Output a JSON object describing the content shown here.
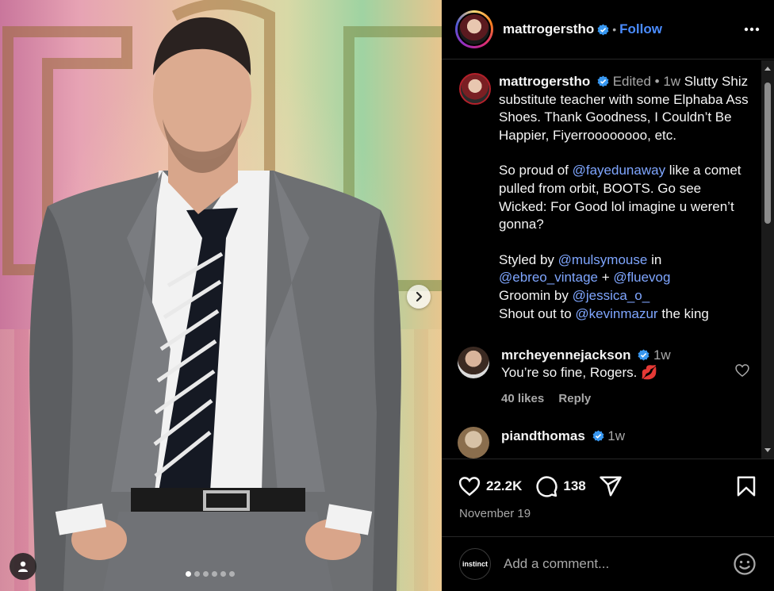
{
  "post": {
    "username": "mattrogerstho",
    "follow_label": "Follow",
    "header_separator": "•"
  },
  "caption": {
    "username": "mattrogerstho",
    "edited": "Edited",
    "bullet": "•",
    "time": "1w",
    "para1": "Slutty Shiz substitute teacher with some Elphaba Ass Shoes. Thank Goodness, I Couldn’t Be Happier, Fiyerroooooooo, etc.",
    "para2_before": "So proud of ",
    "para2_mention": "@fayedunaway",
    "para2_after": " like a comet pulled from orbit, BOOTS. Go see Wicked: For Good lol imagine u weren’t gonna?",
    "styled_by": "Styled by ",
    "styled_mention1": "@mulsymouse",
    "styled_in": " in",
    "styled_mention2": "@ebreo_vintage",
    "styled_plus": " + ",
    "styled_mention3": "@fluevog",
    "groomin_by": "Groomin by ",
    "groomin_mention": "@jessica_o_",
    "shout_out": "Shout out to ",
    "shout_mention": "@kevinmazur",
    "shout_after": " the king"
  },
  "comments": [
    {
      "username": "mrcheyennejackson",
      "time": "1w",
      "text": "You’re so fine, Rogers. 💋",
      "likes": "40 likes",
      "reply_label": "Reply"
    },
    {
      "username": "piandthomas",
      "time": "1w"
    }
  ],
  "stats": {
    "likes": "22.2K",
    "comments": "138",
    "date": "November 19"
  },
  "composer": {
    "placeholder": "Add a comment...",
    "avatar_text": "instinct"
  },
  "carousel": {
    "slide_count": 6,
    "active_index": 0
  },
  "colors": {
    "accent": "#4a8cff",
    "mention": "#7fa6ff",
    "muted": "#a8a8a8",
    "background": "#000000"
  },
  "icons": [
    "more-icon",
    "verified-icon",
    "heart-icon",
    "comment-icon",
    "share-icon",
    "bookmark-icon",
    "emoji-icon",
    "chevron-right-icon",
    "user-tag-icon"
  ]
}
